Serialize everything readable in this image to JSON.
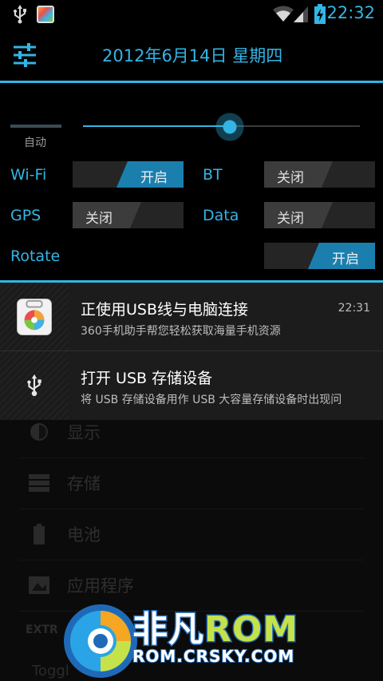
{
  "status_bar": {
    "time": "22:32",
    "icons": [
      "usb-icon",
      "app-360-icon",
      "wifi-icon",
      "signal-icon",
      "battery-charging-icon"
    ]
  },
  "header": {
    "date": "2012年6月14日 星期四",
    "settings_icon": "tune-sliders-icon"
  },
  "brightness": {
    "auto_label": "自动",
    "level": 0.53
  },
  "toggles": [
    {
      "label": "Wi-Fi",
      "state": "on",
      "state_text": "开启"
    },
    {
      "label": "BT",
      "state": "off",
      "state_text": "关闭"
    },
    {
      "label": "GPS",
      "state": "off",
      "state_text": "关闭"
    },
    {
      "label": "Data",
      "state": "off",
      "state_text": "关闭"
    },
    {
      "label": "Rotate",
      "state": "on",
      "state_text": "开启"
    }
  ],
  "notifications": [
    {
      "title": "正使用USB线与电脑连接",
      "subtitle": "360手机助手帮您轻松获取海量手机资源",
      "time": "22:31",
      "icon": "app-360-icon"
    },
    {
      "title": "打开 USB 存储设备",
      "subtitle": "将 USB 存储设备用作 USB 大容量存储设备时出现问",
      "icon": "usb-icon"
    }
  ],
  "settings_list": [
    {
      "label": "显示",
      "icon": "brightness-icon"
    },
    {
      "label": "存储",
      "icon": "storage-icon"
    },
    {
      "label": "电池",
      "icon": "battery-icon"
    },
    {
      "label": "应用程序",
      "icon": "apps-icon"
    }
  ],
  "extra_section": "EXTR",
  "extra_item": "Toggl",
  "watermark": {
    "brand_part1": "非凡",
    "brand_part2": "ROM",
    "domain": "ROM.CRSKY.COM"
  },
  "colors": {
    "accent": "#33b5e5",
    "toggle_on": "#1b7fae",
    "background": "#000000"
  }
}
